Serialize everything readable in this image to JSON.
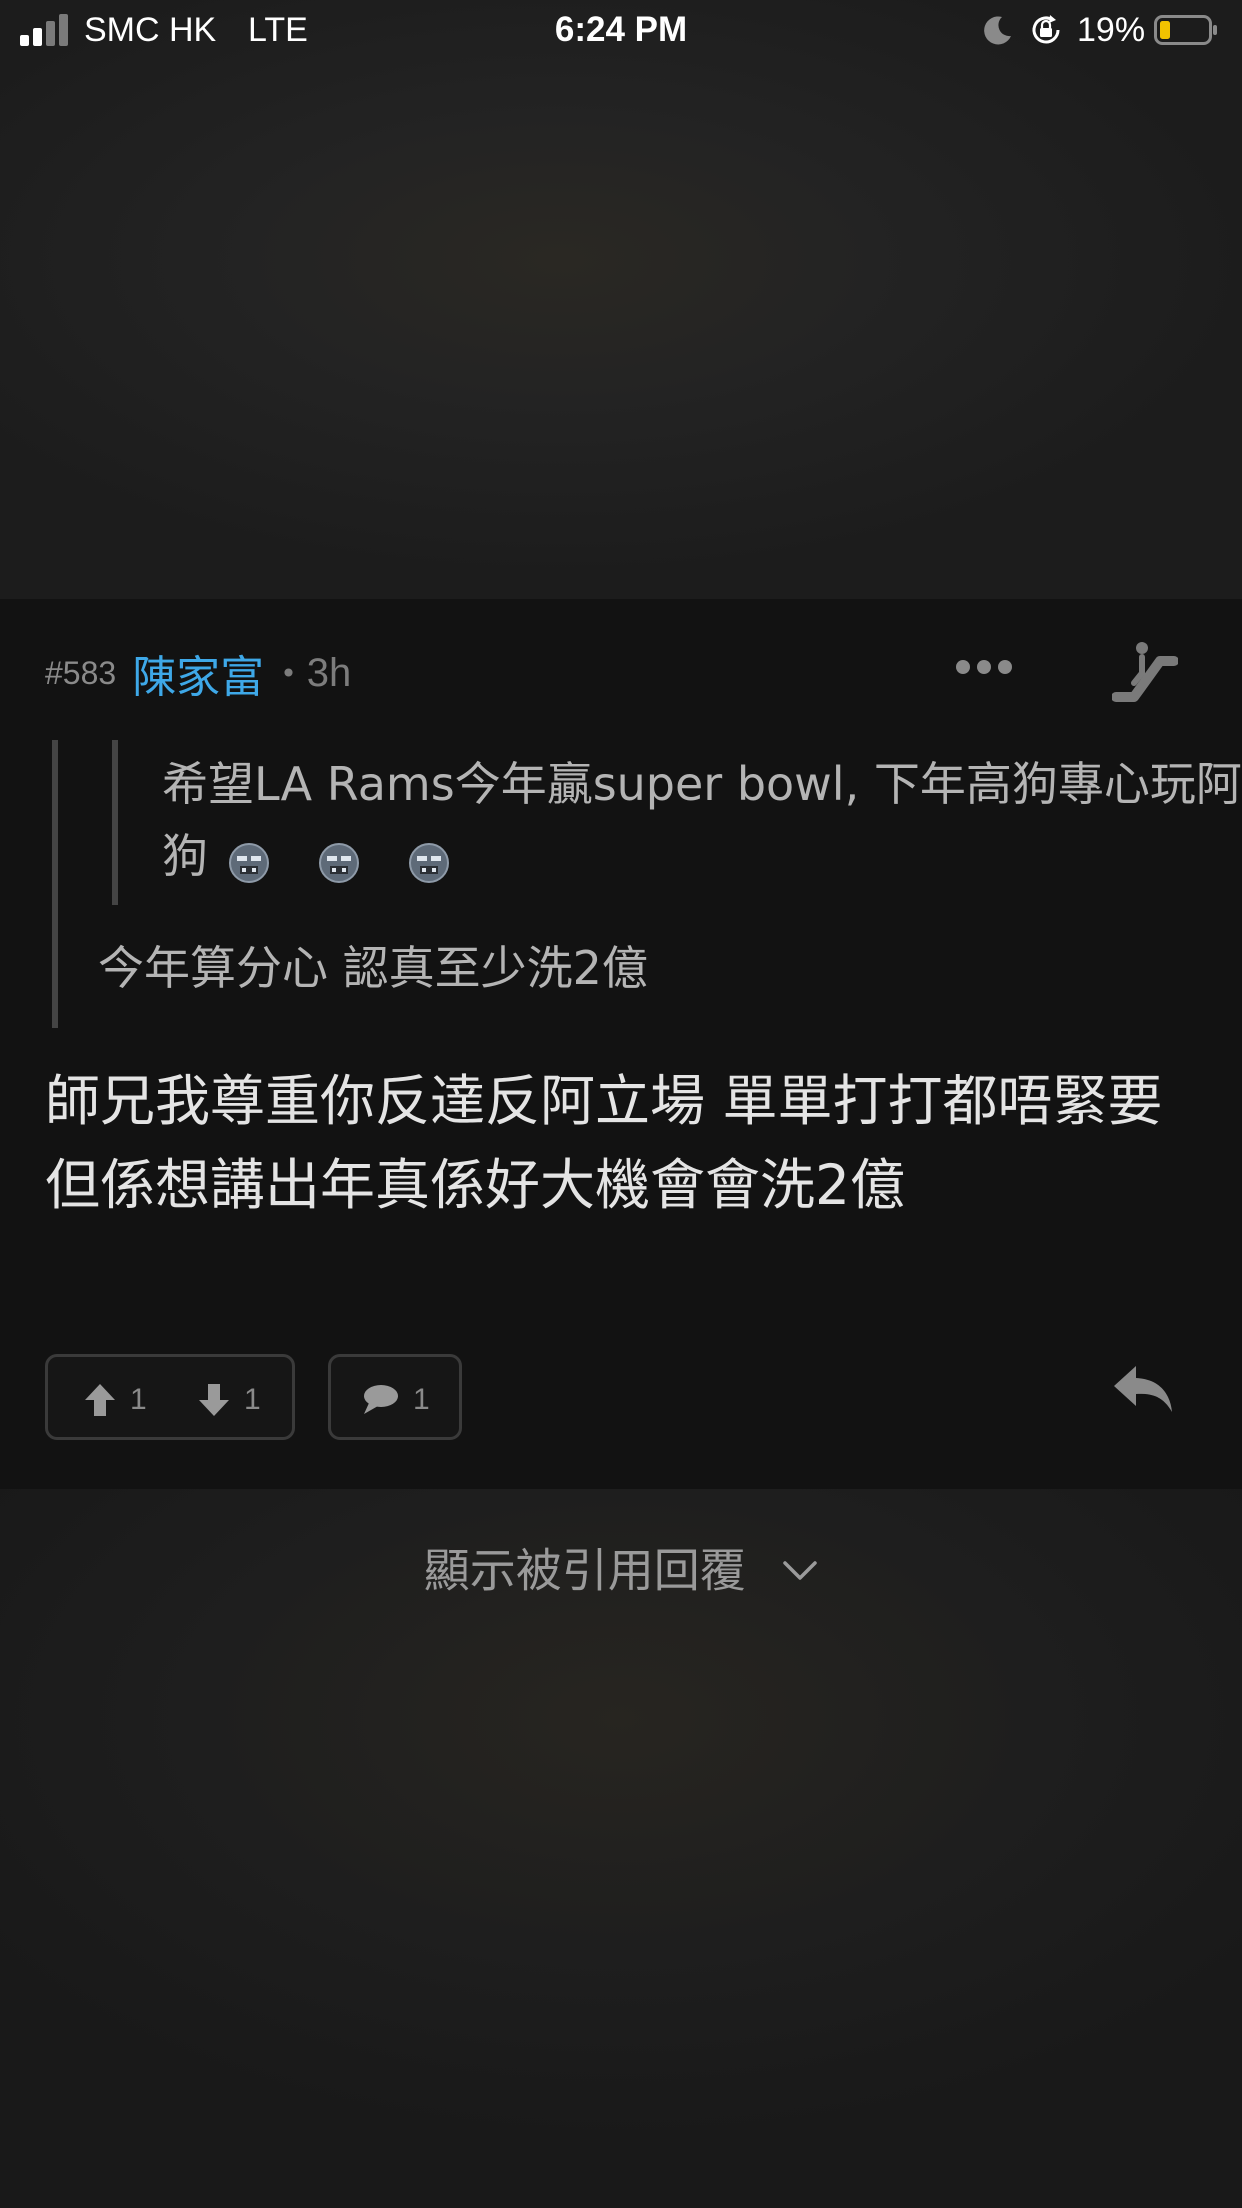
{
  "status_bar": {
    "carrier": "SMC HK",
    "network": "LTE",
    "time": "6:24 PM",
    "battery_percent": "19%",
    "battery_level": 0.19,
    "battery_color": "#f2c200",
    "icons": [
      "signal-icon",
      "moon-icon",
      "rotation-lock-icon",
      "battery-icon"
    ]
  },
  "post": {
    "floor_number": "#583",
    "username": "陳家富",
    "username_color": "#3ea8e8",
    "separator": "•",
    "time_ago": "3h",
    "nested_quote": {
      "text": "希望LA Rams今年贏super bowl, 下年高狗專心玩阿狗",
      "emojis": [
        "crying-face-emoji",
        "crying-face-emoji",
        "crying-face-emoji"
      ]
    },
    "quote": {
      "text": "今年算分心 認真至少洗2億"
    },
    "body_lines": [
      "師兄我尊重你反達反阿立場 單單打打都唔緊要",
      "但係想講出年真係好大機會會洗2億"
    ],
    "upvotes": "1",
    "downvotes": "1",
    "comments": "1",
    "icons": [
      "more-icon",
      "escalator-icon",
      "upvote-icon",
      "downvote-icon",
      "comment-icon",
      "reply-icon"
    ]
  },
  "show_quoted_replies": {
    "label": "顯示被引用回覆",
    "icon": "chevron-down-icon"
  }
}
